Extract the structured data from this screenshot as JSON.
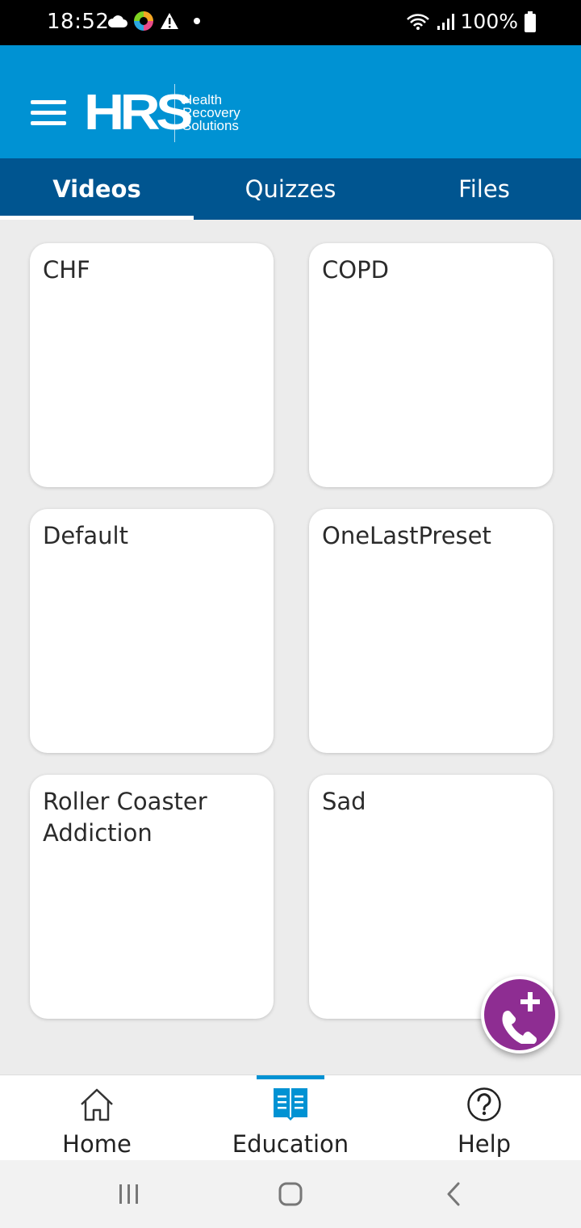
{
  "status_bar": {
    "time": "18:52",
    "battery": "100%",
    "icons_left": [
      "cloud-icon",
      "app-notification-icon",
      "warning-icon",
      "dot-icon"
    ],
    "icons_right": [
      "wifi-icon",
      "signal-icon",
      "battery-icon"
    ]
  },
  "app_bar": {
    "logo_mark": "HRS",
    "logo_line1": "Health",
    "logo_line2": "Recovery",
    "logo_line3": "Solutions",
    "brand_color": "#0092d3"
  },
  "tabs": [
    {
      "label": "Videos",
      "active": true
    },
    {
      "label": "Quizzes",
      "active": false
    },
    {
      "label": "Files",
      "active": false
    }
  ],
  "cards": [
    {
      "title": "CHF"
    },
    {
      "title": "COPD"
    },
    {
      "title": "Default"
    },
    {
      "title": "OneLastPreset"
    },
    {
      "title": "Roller Coaster Addiction"
    },
    {
      "title": "Sad"
    }
  ],
  "fab": {
    "icon": "phone-add-icon",
    "color": "#8e2d92"
  },
  "bottom_nav": [
    {
      "label": "Home",
      "icon": "home-icon",
      "active": false
    },
    {
      "label": "Education",
      "icon": "book-icon",
      "active": true
    },
    {
      "label": "Help",
      "icon": "help-icon",
      "active": false
    }
  ],
  "system_nav": [
    "recents-icon",
    "home-circle-icon",
    "back-icon"
  ]
}
